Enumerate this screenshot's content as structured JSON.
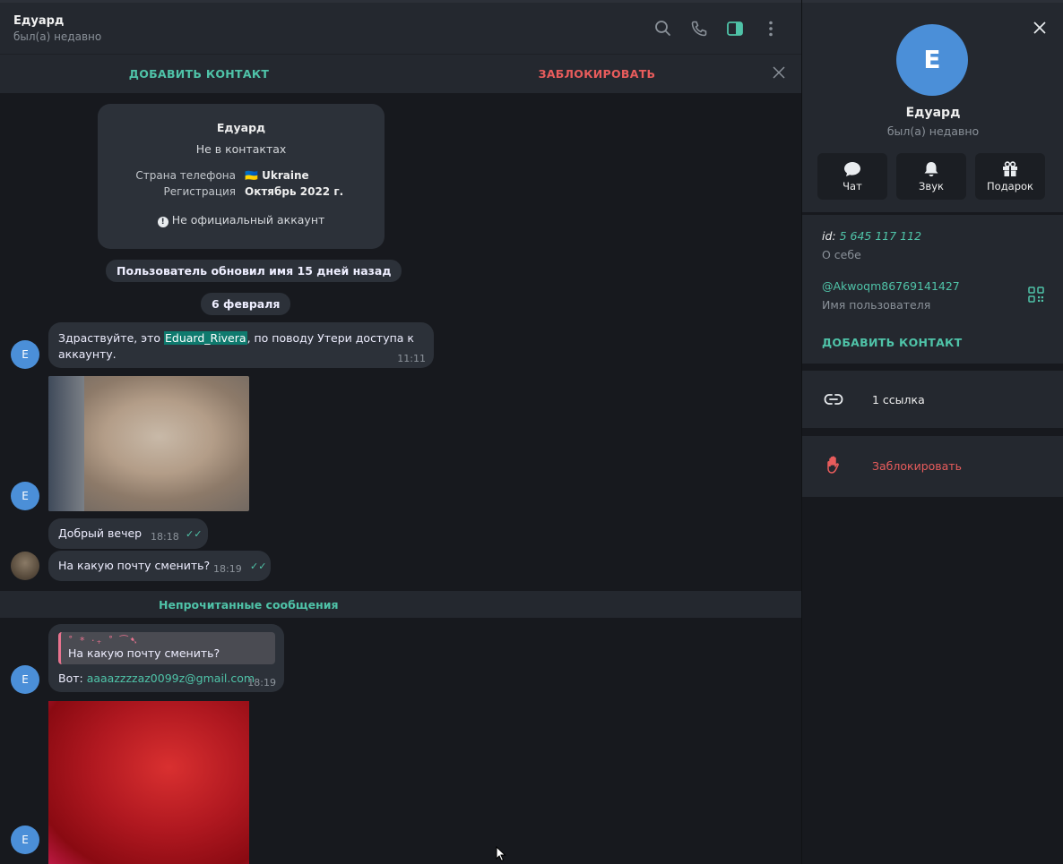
{
  "header": {
    "name": "Едуард",
    "status": "был(а) недавно"
  },
  "actionbar": {
    "add_contact": "ДОБАВИТЬ КОНТАКТ",
    "block": "ЗАБЛОКИРОВАТЬ"
  },
  "info_card": {
    "name": "Едуард",
    "not_in_contacts": "Не в контактах",
    "phone_country_label": "Страна телефона",
    "phone_country_value": "🇺🇦 Ukraine",
    "registration_label": "Регистрация",
    "registration_value": "Октябрь 2022 г.",
    "unofficial": "Не официальный аккаунт"
  },
  "service": {
    "name_updated": "Пользователь обновил имя 15 дней назад",
    "date": "6 февраля"
  },
  "messages": {
    "m1_prefix": "Здраствуйте, это ",
    "m1_highlight": "Eduard_Rivera",
    "m1_suffix": ", по поводу Утери доступа к",
    "m1_line2": "аккаунту.",
    "m1_time": "11:11",
    "m2_text": "Добрый вечер",
    "m2_time": "18:18",
    "m3_text": "На какую почту сменить?",
    "m3_time": "18:19",
    "unread_label": "Непрочитанные сообщения",
    "m4_reply_deco": "˚ * ‧₊ ˚ ⁀➷",
    "m4_reply_text": "На какую почту сменить?",
    "m4_prefix": "Вот: ",
    "m4_email": "aaaazzzzaz0099z@gmail.com",
    "m4_time": "18:19"
  },
  "avatar_letter": "E",
  "panel": {
    "avatar_letter": "E",
    "name": "Едуард",
    "status": "был(а) недавно",
    "btn_chat": "Чат",
    "btn_sound": "Звук",
    "btn_gift": "Подарок",
    "id_label": "id: ",
    "id_value": "5 645 117 112",
    "about_label": "О себе",
    "username": "@Akwoqm86769141427",
    "username_label": "Имя пользователя",
    "add_contact": "ДОБАВИТЬ КОНТАКТ",
    "links": "1 ссылка",
    "block": "Заблокировать"
  },
  "colors": {
    "accent": "#4fc3a8",
    "danger": "#e85c5c",
    "avatar": "#4b8fd8"
  }
}
